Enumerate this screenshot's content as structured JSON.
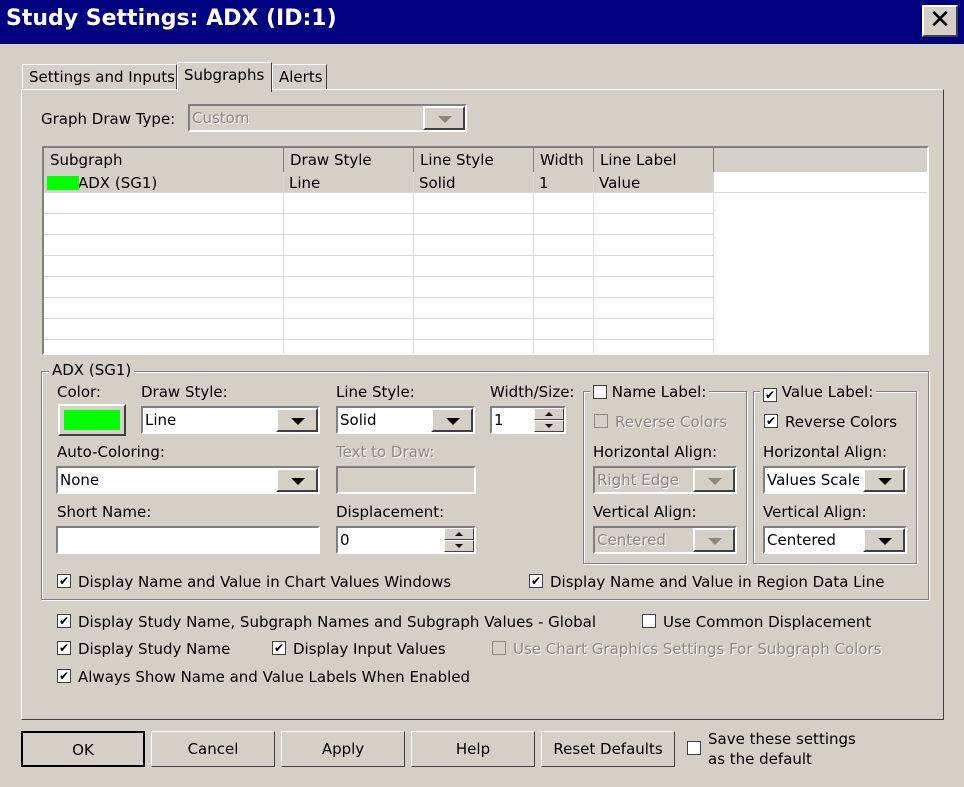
{
  "window": {
    "title": "Study Settings: ADX (ID:1)"
  },
  "tabs": [
    "Settings and Inputs",
    "Subgraphs",
    "Alerts"
  ],
  "graph_draw_type": {
    "label": "Graph Draw Type:",
    "value": "Custom"
  },
  "grid": {
    "columns": [
      "Subgraph",
      "Draw Style",
      "Line Style",
      "Width",
      "Line Label"
    ],
    "rows": [
      {
        "subgraph": "ADX (SG1)",
        "draw_style": "Line",
        "line_style": "Solid",
        "width": "1",
        "line_label": "Value",
        "color": "#00ff00"
      }
    ]
  },
  "subgraph_group": {
    "title": "ADX (SG1)",
    "color_label": "Color:",
    "color_value": "#00ff00",
    "draw_style_label": "Draw Style:",
    "draw_style": "Line",
    "line_style_label": "Line Style:",
    "line_style": "Solid",
    "width_label": "Width/Size:",
    "width": "1",
    "auto_coloring_label": "Auto-Coloring:",
    "auto_coloring": "None",
    "text_to_draw_label": "Text to Draw:",
    "text_to_draw": "",
    "short_name_label": "Short Name:",
    "short_name": "",
    "displacement_label": "Displacement:",
    "displacement": "0",
    "name_label": {
      "label": "Name Label:",
      "checked": false,
      "reverse_colors": "Reverse Colors",
      "h_align_label": "Horizontal Align:",
      "h_align": "Right Edge",
      "v_align_label": "Vertical Align:",
      "v_align": "Centered"
    },
    "value_label": {
      "label": "Value Label:",
      "checked": true,
      "reverse_colors": "Reverse Colors",
      "h_align_label": "Horizontal Align:",
      "h_align": "Values Scale",
      "v_align_label": "Vertical Align:",
      "v_align": "Centered"
    },
    "display_chart_values": "Display Name and Value in Chart Values Windows",
    "display_region_data": "Display Name and Value in Region Data Line"
  },
  "options": {
    "global": "Display Study Name, Subgraph Names and Subgraph Values - Global",
    "common_displacement": "Use Common Displacement",
    "study_name": "Display Study Name",
    "input_values": "Display Input Values",
    "chart_graphics": "Use Chart Graphics Settings For Subgraph Colors",
    "always_show": "Always Show Name and Value Labels When Enabled"
  },
  "buttons": {
    "ok": "OK",
    "cancel": "Cancel",
    "apply": "Apply",
    "help": "Help",
    "reset": "Reset Defaults",
    "save_line1": "Save these settings",
    "save_line2": "as the default"
  }
}
